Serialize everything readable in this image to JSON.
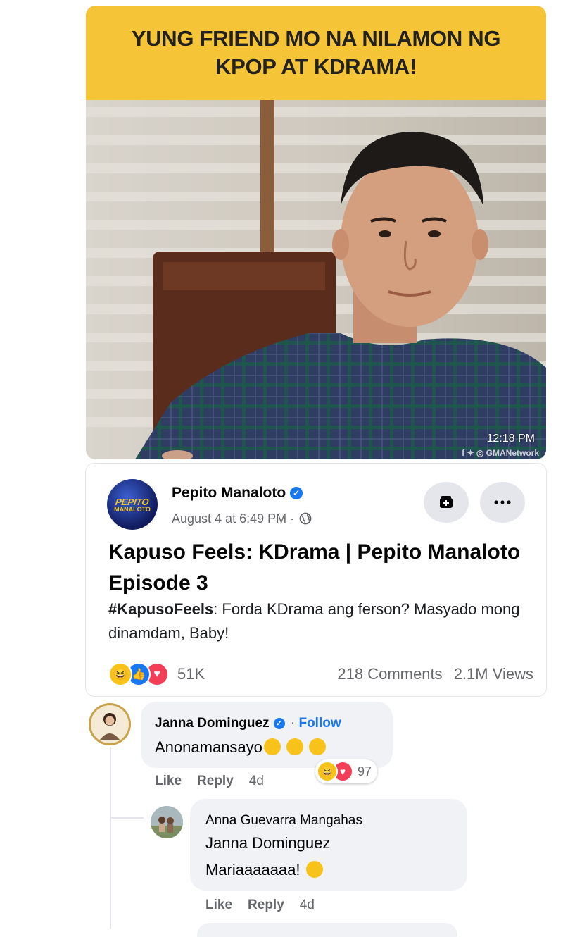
{
  "video": {
    "banner_line1": "YUNG FRIEND MO NA NILAMON NG",
    "banner_line2": "KPOP AT KDRAMA!",
    "timestamp": "12:18 PM",
    "watermark": "GMANetwork",
    "banner_color": "#f6c437"
  },
  "post": {
    "avatar_text_line1": "PEPITO",
    "avatar_text_line2": "MANALOTO",
    "author": "Pepito Manaloto",
    "date": "August 4 at 6:49 PM ·",
    "title": "Kapuso Feels: KDrama | Pepito Manaloto Episode 3",
    "hashtag": "#KapusoFeels",
    "description": ": Forda KDrama ang ferson? Masyado mong dinamdam, Baby!",
    "reaction_count": "51K",
    "comments": "218 Comments",
    "views": "2.1M Views",
    "save_icon": "save-icon",
    "more_icon": "more-icon"
  },
  "comments": [
    {
      "author": "Janna Dominguez",
      "follow": "Follow",
      "separator": "·",
      "text": "Anonamansayo",
      "reaction_count": "97",
      "like": "Like",
      "reply": "Reply",
      "time": "4d"
    }
  ],
  "reply": {
    "author": "Anna Guevarra Mangahas",
    "mention": "Janna Dominguez",
    "text": "Mariaaaaaaa!",
    "like": "Like",
    "reply": "Reply",
    "time": "4d"
  },
  "colors": {
    "accent": "#1877f2",
    "secondary_text": "#65676b",
    "bubble": "#f0f2f5"
  }
}
